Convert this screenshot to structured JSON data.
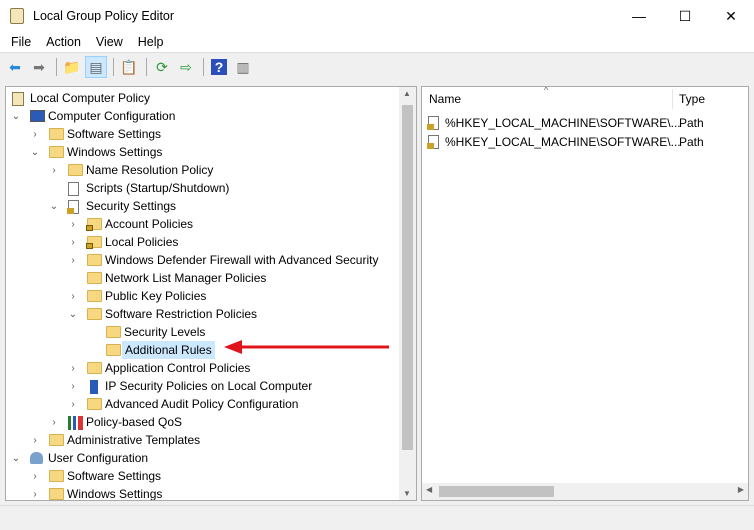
{
  "window": {
    "title": "Local Group Policy Editor",
    "min": "—",
    "max": "☐",
    "close": "✕"
  },
  "menu": [
    "File",
    "Action",
    "View",
    "Help"
  ],
  "tree": [
    {
      "level": 0,
      "label": "Local Computer Policy",
      "exp": "none",
      "icon": "policy"
    },
    {
      "level": 1,
      "label": "Computer Configuration",
      "exp": "open",
      "icon": "computer"
    },
    {
      "level": 2,
      "label": "Software Settings",
      "exp": "closed",
      "icon": "folder"
    },
    {
      "level": 2,
      "label": "Windows Settings",
      "exp": "open",
      "icon": "folder"
    },
    {
      "level": 3,
      "label": "Name Resolution Policy",
      "exp": "closed",
      "icon": "folder"
    },
    {
      "level": 3,
      "label": "Scripts (Startup/Shutdown)",
      "exp": "none",
      "icon": "script"
    },
    {
      "level": 3,
      "label": "Security Settings",
      "exp": "open",
      "icon": "security"
    },
    {
      "level": 4,
      "label": "Account Policies",
      "exp": "closed",
      "icon": "lockfolder"
    },
    {
      "level": 4,
      "label": "Local Policies",
      "exp": "closed",
      "icon": "lockfolder"
    },
    {
      "level": 4,
      "label": "Windows Defender Firewall with Advanced Security",
      "exp": "closed",
      "icon": "folder"
    },
    {
      "level": 4,
      "label": "Network List Manager Policies",
      "exp": "none",
      "icon": "folder"
    },
    {
      "level": 4,
      "label": "Public Key Policies",
      "exp": "closed",
      "icon": "folder"
    },
    {
      "level": 4,
      "label": "Software Restriction Policies",
      "exp": "open",
      "icon": "folder"
    },
    {
      "level": 5,
      "label": "Security Levels",
      "exp": "none",
      "icon": "folder"
    },
    {
      "level": 5,
      "label": "Additional Rules",
      "exp": "none",
      "icon": "folder",
      "selected": true
    },
    {
      "level": 4,
      "label": "Application Control Policies",
      "exp": "closed",
      "icon": "folder"
    },
    {
      "level": 4,
      "label": "IP Security Policies on Local Computer",
      "exp": "closed",
      "icon": "ipsec"
    },
    {
      "level": 4,
      "label": "Advanced Audit Policy Configuration",
      "exp": "closed",
      "icon": "folder"
    },
    {
      "level": 3,
      "label": "Policy-based QoS",
      "exp": "closed",
      "icon": "qos"
    },
    {
      "level": 2,
      "label": "Administrative Templates",
      "exp": "closed",
      "icon": "folder"
    },
    {
      "level": 1,
      "label": "User Configuration",
      "exp": "open",
      "icon": "user"
    },
    {
      "level": 2,
      "label": "Software Settings",
      "exp": "closed",
      "icon": "folder"
    },
    {
      "level": 2,
      "label": "Windows Settings",
      "exp": "closed",
      "icon": "folder"
    }
  ],
  "list": {
    "columns": [
      "Name",
      "Type"
    ],
    "rows": [
      {
        "name": "%HKEY_LOCAL_MACHINE\\SOFTWARE\\...",
        "type": "Path"
      },
      {
        "name": "%HKEY_LOCAL_MACHINE\\SOFTWARE\\...",
        "type": "Path"
      }
    ]
  },
  "colors": {
    "arrow": "#e0141b",
    "selection": "#cce8ff"
  }
}
